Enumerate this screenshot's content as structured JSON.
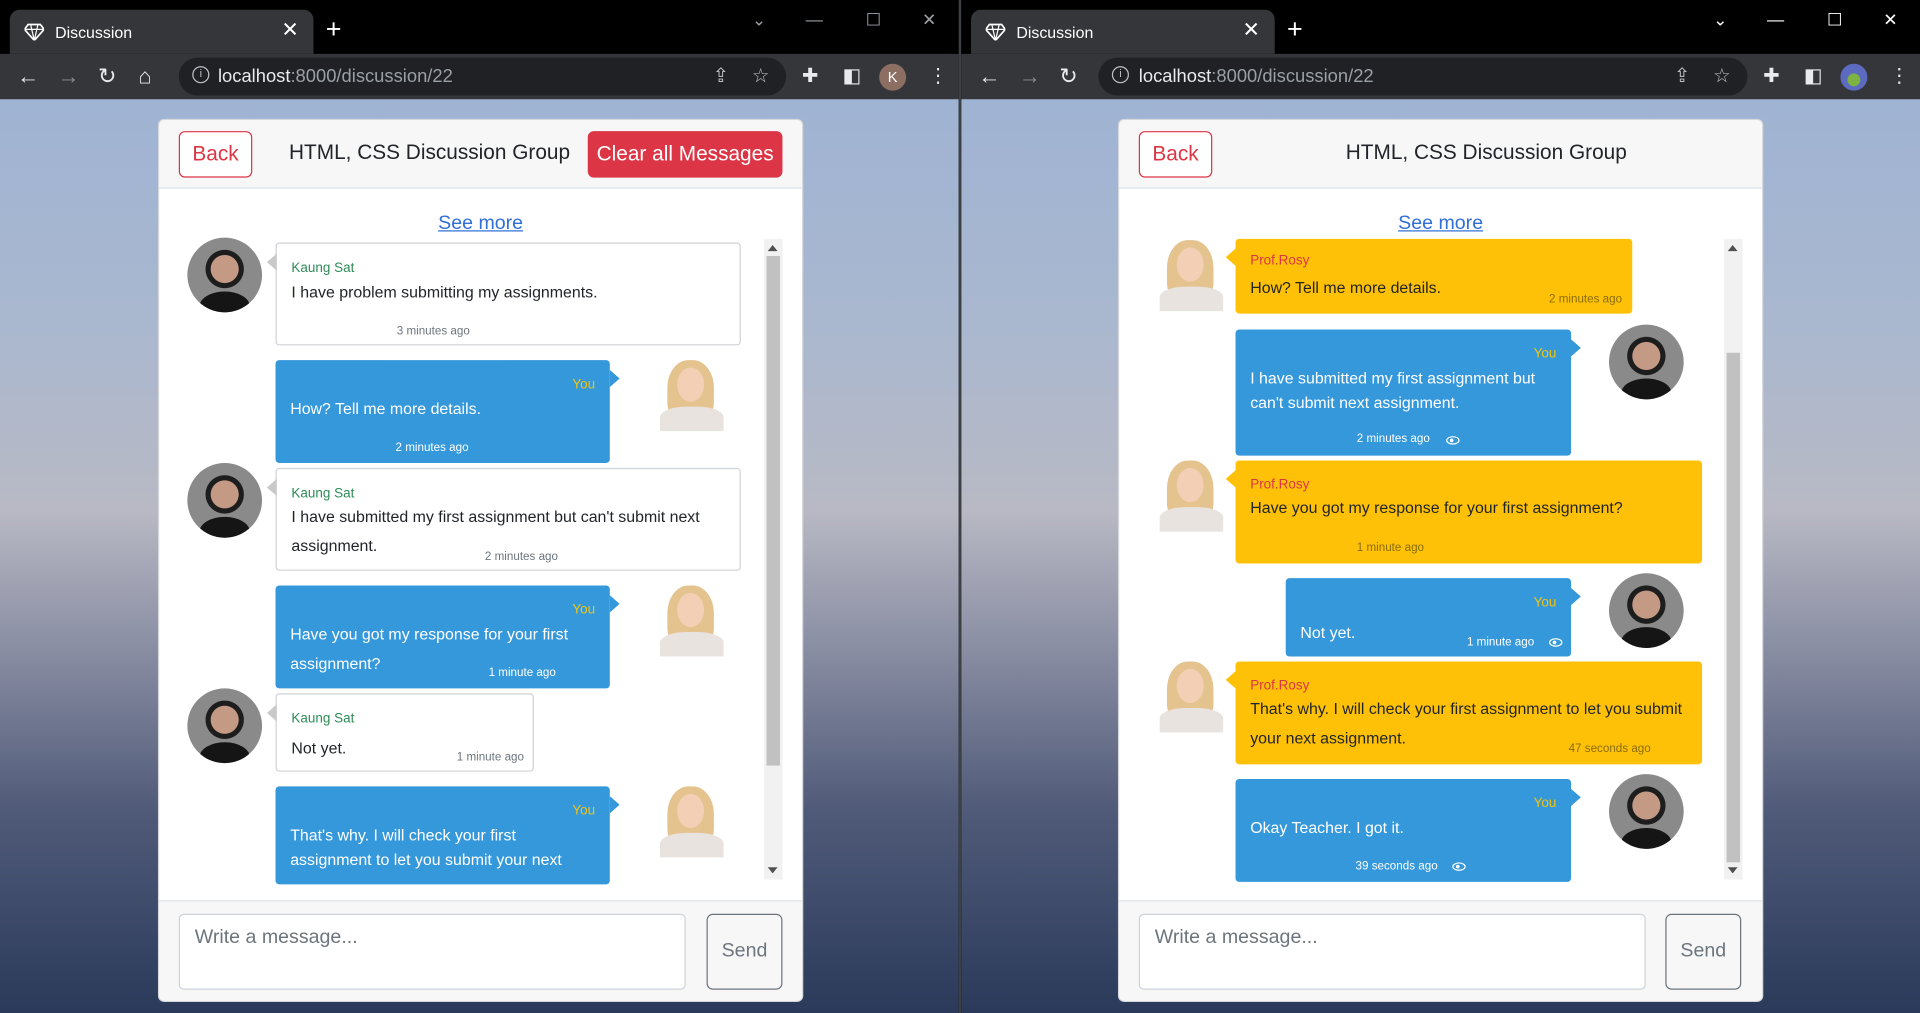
{
  "browser": {
    "tab_title": "Discussion",
    "url_host": "localhost",
    "url_path": ":8000/discussion/22",
    "left_profile_initial": "K"
  },
  "chat": {
    "title": "HTML, CSS Discussion Group",
    "back_label": "Back",
    "clear_label": "Clear all Messages",
    "see_more": "See more",
    "composer_placeholder": "Write a message...",
    "send_label": "Send"
  },
  "left_messages": [
    {
      "name": "Kaung Sat",
      "text": "I have problem submitting my assignments.",
      "time": "3 minutes ago"
    },
    {
      "name": "You",
      "text": "How? Tell me more details.",
      "time": "2 minutes ago"
    },
    {
      "name": "Kaung Sat",
      "text": "I have submitted my first assignment but can't submit next assignment.",
      "time": "2 minutes ago"
    },
    {
      "name": "You",
      "text": "Have you got my response for your first assignment?",
      "time": "1 minute ago"
    },
    {
      "name": "Kaung Sat",
      "text": "Not yet.",
      "time": "1 minute ago"
    },
    {
      "name": "You",
      "text": "That's why. I will check your first assignment to let you submit your next"
    }
  ],
  "right_messages": [
    {
      "name": "Prof.Rosy",
      "text": "How? Tell me more details.",
      "time": "2 minutes ago"
    },
    {
      "name": "You",
      "text": "I have submitted my first assignment but can't submit next assignment.",
      "time": "2 minutes ago"
    },
    {
      "name": "Prof.Rosy",
      "text": "Have you got my response for your first assignment?",
      "time": "1 minute ago"
    },
    {
      "name": "You",
      "text": "Not yet.",
      "time": "1 minute ago"
    },
    {
      "name": "Prof.Rosy",
      "text": "That's why. I will check your first assignment to let you submit your next assignment.",
      "time": "47 seconds ago"
    },
    {
      "name": "You",
      "text": "Okay Teacher. I got it.",
      "time": "39 seconds ago"
    }
  ],
  "colors": {
    "danger": "#dc3545",
    "chat_blue": "#3498db",
    "chat_yellow": "#ffc107",
    "link": "#2f6fd6"
  }
}
